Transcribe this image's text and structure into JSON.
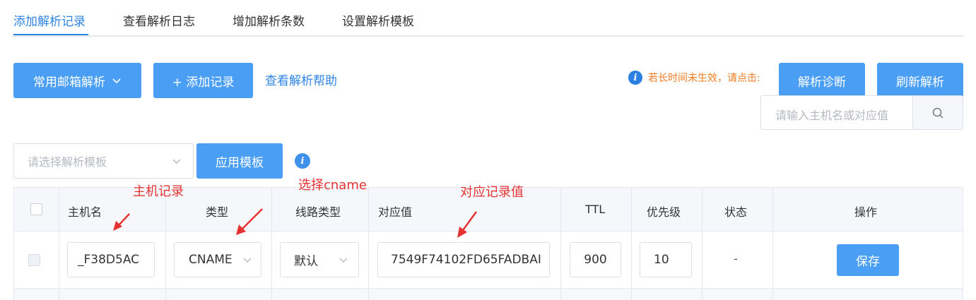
{
  "tabs": [
    {
      "label": "添加解析记录",
      "active": true
    },
    {
      "label": "查看解析日志",
      "active": false
    },
    {
      "label": "增加解析条数",
      "active": false
    },
    {
      "label": "设置解析模板",
      "active": false
    }
  ],
  "toolbar": {
    "mail_button": "常用邮箱解析",
    "add_button": "+ 添加记录",
    "help_link": "查看解析帮助",
    "notice": "若长时间未生效，请点击:",
    "diagnose_button": "解析诊断",
    "refresh_button": "刷新解析",
    "search_placeholder": "请输入主机名或对应值"
  },
  "template": {
    "select_placeholder": "请选择解析模板",
    "apply_button": "应用模板"
  },
  "table": {
    "headers": {
      "host": "主机名",
      "type": "类型",
      "line": "线路类型",
      "value": "对应值",
      "ttl": "TTL",
      "priority": "优先级",
      "status": "状态",
      "action": "操作"
    },
    "row": {
      "host": "_F38D5AC",
      "type": "CNAME",
      "line": "默认",
      "value": "7549F74102FD65FADBAI",
      "ttl": "900",
      "priority": "10",
      "status": "-",
      "save_button": "保存"
    }
  },
  "annotations": {
    "host": "主机记录",
    "type": "选择cname",
    "value": "对应记录值"
  },
  "colors": {
    "accent": "#2f84e4",
    "button": "#4a9ff5",
    "notice": "#f07b20",
    "annotation": "#e53232"
  },
  "icons": [
    "chevron-down-icon",
    "info-icon",
    "search-icon",
    "arrow-annotation-icon"
  ]
}
